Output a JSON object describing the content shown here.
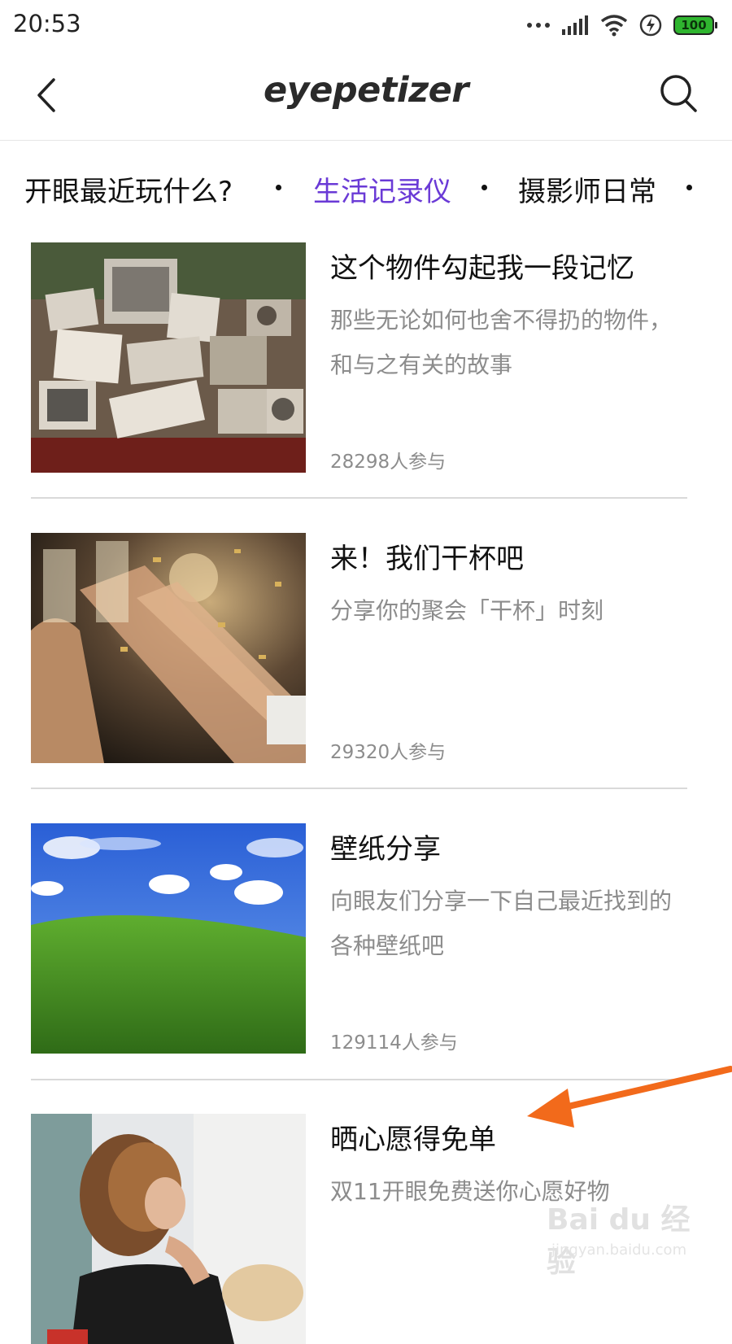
{
  "status_bar": {
    "time": "20:53",
    "battery": "100",
    "icons": [
      "more-dots-icon",
      "signal-icon",
      "wifi-icon",
      "charging-icon",
      "battery-icon"
    ]
  },
  "header": {
    "logo": "eyepetizer",
    "back_icon": "chevron-left-icon",
    "search_icon": "search-icon"
  },
  "tabs": [
    {
      "label": "开眼最近玩什么?",
      "active": false
    },
    {
      "label": "生活记录仪",
      "active": true
    },
    {
      "label": "摄影师日常",
      "active": false
    }
  ],
  "colors": {
    "active_tab": "#6a3ad6",
    "secondary_text": "#8c8c8c",
    "divider": "#d9d9d9",
    "annotation_arrow": "#f26a1b"
  },
  "topics": [
    {
      "title": "这个物件勾起我一段记忆",
      "desc": "那些无论如何也舍不得扔的物件，和与之有关的故事",
      "count": "28298人参与",
      "thumb": "old-photos-image"
    },
    {
      "title": "来！我们干杯吧",
      "desc": "分享你的聚会「干杯」时刻",
      "count": "29320人参与",
      "thumb": "party-cheers-image"
    },
    {
      "title": "壁纸分享",
      "desc": "向眼友们分享一下自己最近找到的各种壁纸吧",
      "count": "129114人参与",
      "thumb": "green-hill-wallpaper-image"
    },
    {
      "title": "晒心愿得免单",
      "desc": "双11开眼免费送你心愿好物",
      "count": "",
      "thumb": "woman-portrait-image"
    }
  ],
  "watermark": {
    "text": "Bai du 经验",
    "sub": "jingyan.baidu.com"
  }
}
